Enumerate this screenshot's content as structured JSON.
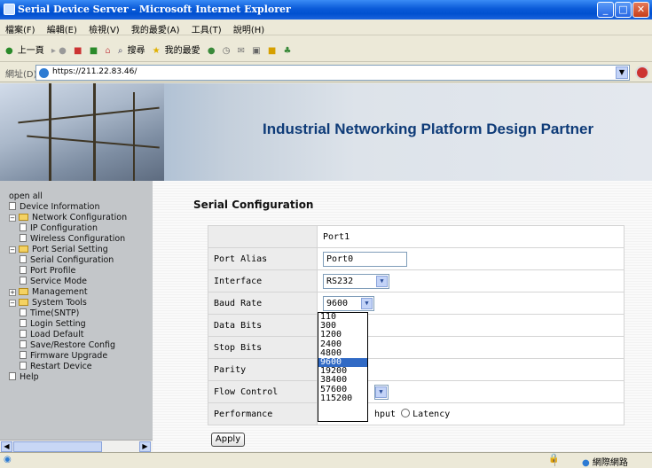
{
  "window": {
    "title": "Serial Device Server - Microsoft Internet Explorer"
  },
  "menu": [
    "檔案(F)",
    "編輯(E)",
    "檢視(V)",
    "我的最愛(A)",
    "工具(T)",
    "說明(H)"
  ],
  "toolbar": {
    "back": "上一頁",
    "search": "搜尋",
    "favorites": "我的最愛"
  },
  "address": {
    "label": "網址(D)",
    "url": "https://211.22.83.46/"
  },
  "banner": {
    "title": "Industrial Networking Platform Design Partner"
  },
  "sidebar": {
    "open_all": "open all",
    "items": [
      {
        "label": "Device Information"
      },
      {
        "label": "Network Configuration"
      },
      {
        "label": "IP Configuration"
      },
      {
        "label": "Wireless Configuration"
      },
      {
        "label": "Port Serial Setting"
      },
      {
        "label": "Serial Configuration"
      },
      {
        "label": "Port Profile"
      },
      {
        "label": "Service Mode"
      },
      {
        "label": "Management"
      },
      {
        "label": "System Tools"
      },
      {
        "label": "Time(SNTP)"
      },
      {
        "label": "Login Setting"
      },
      {
        "label": "Load Default"
      },
      {
        "label": "Save/Restore Config"
      },
      {
        "label": "Firmware Upgrade"
      },
      {
        "label": "Restart Device"
      },
      {
        "label": "Help"
      }
    ]
  },
  "page": {
    "title": "Serial Configuration",
    "port_header": "Port1",
    "rows": {
      "port_alias": {
        "label": "Port Alias",
        "value": "Port0"
      },
      "interface": {
        "label": "Interface",
        "value": "RS232"
      },
      "baud_rate": {
        "label": "Baud Rate",
        "value": "9600"
      },
      "data_bits": {
        "label": "Data Bits"
      },
      "stop_bits": {
        "label": "Stop Bits"
      },
      "parity": {
        "label": "Parity"
      },
      "flow_control": {
        "label": "Flow Control"
      },
      "performance": {
        "label": "Performance",
        "option1_partial": "hput",
        "option2": "Latency"
      }
    },
    "apply_label": "Apply"
  },
  "baud_dropdown": {
    "options": [
      "110",
      "300",
      "1200",
      "2400",
      "4800",
      "9600",
      "19200",
      "38400",
      "57600",
      "115200"
    ],
    "selected": "9600"
  },
  "status": {
    "zone": "網際網路"
  }
}
